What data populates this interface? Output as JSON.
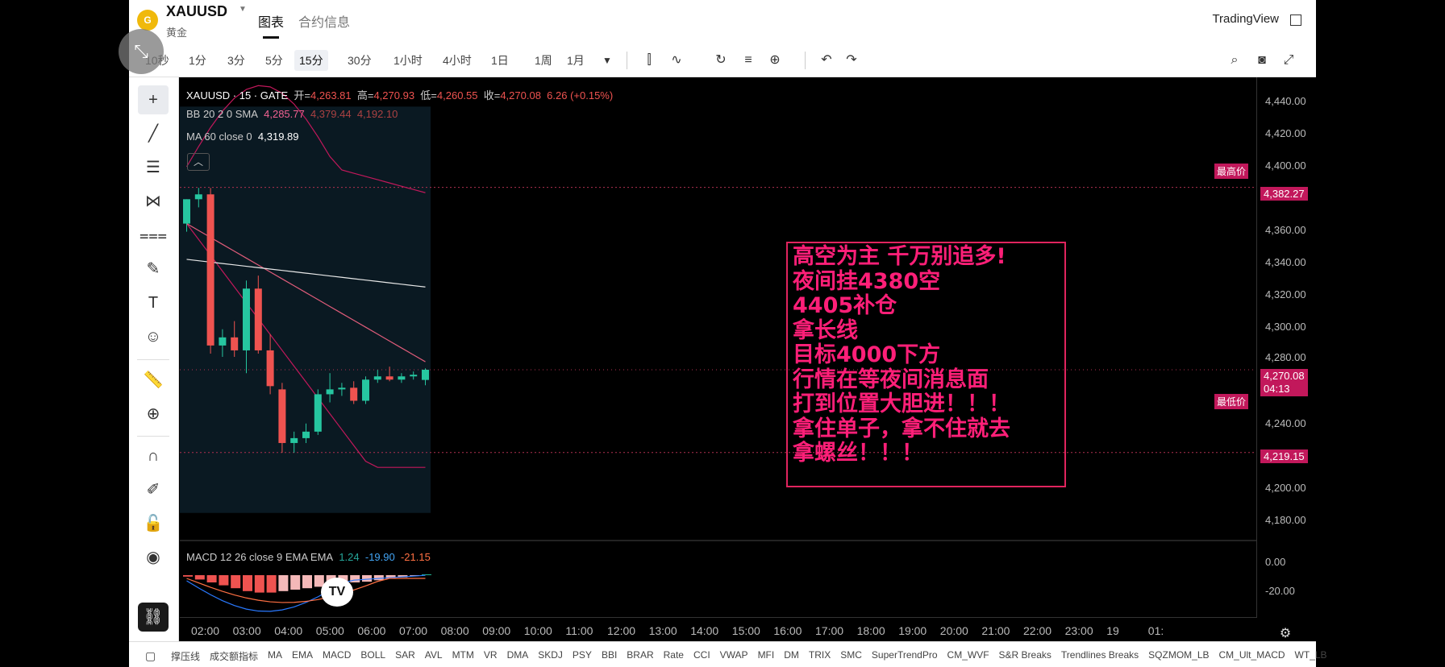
{
  "header": {
    "symbol": "XAUUSD",
    "subname": "黄金",
    "tabs": [
      {
        "label": "图表"
      },
      {
        "label": "合约信息"
      }
    ],
    "brand": "TradingView"
  },
  "toolbar": {
    "timeframes": [
      "10秒",
      "1分",
      "3分",
      "5分",
      "15分",
      "30分",
      "1小时",
      "4小时",
      "1日",
      "1周",
      "1月"
    ],
    "active_timeframe": "15分"
  },
  "legend": {
    "title": "XAUUSD · 15 · GATE",
    "open_label": "开=",
    "open": "4,263.81",
    "high_label": "高=",
    "high": "4,270.93",
    "low_label": "低=",
    "low": "4,260.55",
    "close_label": "收=",
    "close": "4,270.08",
    "change": "6.26 (+0.15%)",
    "bb_label": "BB 20 2 0 SMA",
    "bb_mid": "4,285.77",
    "bb_up": "4,379.44",
    "bb_low": "4,192.10",
    "ma_label": "MA 60 close 0",
    "ma_val": "4,319.89",
    "macd_label": "MACD 12 26 close 9 EMA EMA",
    "macd_a": "1.24",
    "macd_b": "-19.90",
    "macd_c": "-21.15"
  },
  "price_axis": {
    "ticks": [
      "4,440.00",
      "4,420.00",
      "4,400.00",
      "4,360.00",
      "4,340.00",
      "4,320.00",
      "4,300.00",
      "4,280.00",
      "4,240.00",
      "4,200.00",
      "4,180.00"
    ],
    "high_tag_label": "最高价",
    "high_tag": "4,382.27",
    "last_price": "4,270.08",
    "countdown": "04:13",
    "low_tag_label": "最低价",
    "low_tag": "4,219.15",
    "macd_ticks": [
      "0.00",
      "-20.00"
    ]
  },
  "time_axis": [
    "02:00",
    "03:00",
    "04:00",
    "05:00",
    "06:00",
    "07:00",
    "08:00",
    "09:00",
    "10:00",
    "11:00",
    "12:00",
    "13:00",
    "14:00",
    "15:00",
    "16:00",
    "17:00",
    "18:00",
    "19:00",
    "20:00",
    "21:00",
    "22:00",
    "23:00",
    "19",
    "01:"
  ],
  "annotation": [
    "高空为主 千万别追多!",
    "夜间挂4380空",
    "4405补仓",
    "拿长线",
    "目标4000下方",
    "行情在等夜间消息面",
    "打到位置大胆进！！！",
    "拿住单子，拿不住就去",
    "拿螺丝！！！"
  ],
  "indicators": [
    "撑压线",
    "成交额指标",
    "MA",
    "EMA",
    "MACD",
    "BOLL",
    "SAR",
    "AVL",
    "MTM",
    "VR",
    "DMA",
    "SKDJ",
    "PSY",
    "BBI",
    "BRAR",
    "Rate",
    "CCI",
    "VWAP",
    "MFI",
    "DM",
    "TRIX",
    "SMC",
    "SuperTrendPro",
    "CM_WVF",
    "S&R Breaks",
    "Trendlines Breaks",
    "SQZMOM_LB",
    "CM_Ult_MACD",
    "WT_LB"
  ],
  "chart_data": {
    "type": "candlestick",
    "x": [
      "01:45",
      "02:00",
      "02:15",
      "02:30",
      "02:45",
      "03:00",
      "03:15",
      "03:30",
      "03:45",
      "04:00",
      "04:15",
      "04:30",
      "04:45",
      "05:00",
      "05:15",
      "05:30",
      "05:45",
      "06:00",
      "06:15",
      "06:30",
      "06:45"
    ],
    "candles": [
      {
        "o": 4360,
        "h": 4375,
        "l": 4355,
        "c": 4375
      },
      {
        "o": 4375,
        "h": 4382,
        "l": 4370,
        "c": 4378
      },
      {
        "o": 4378,
        "h": 4382,
        "l": 4280,
        "c": 4285
      },
      {
        "o": 4285,
        "h": 4295,
        "l": 4278,
        "c": 4290
      },
      {
        "o": 4290,
        "h": 4300,
        "l": 4278,
        "c": 4282
      },
      {
        "o": 4282,
        "h": 4325,
        "l": 4268,
        "c": 4320
      },
      {
        "o": 4320,
        "h": 4328,
        "l": 4280,
        "c": 4282
      },
      {
        "o": 4282,
        "h": 4292,
        "l": 4255,
        "c": 4260
      },
      {
        "o": 4258,
        "h": 4262,
        "l": 4219,
        "c": 4225
      },
      {
        "o": 4225,
        "h": 4232,
        "l": 4219,
        "c": 4228
      },
      {
        "o": 4228,
        "h": 4237,
        "l": 4225,
        "c": 4232
      },
      {
        "o": 4232,
        "h": 4258,
        "l": 4230,
        "c": 4255
      },
      {
        "o": 4255,
        "h": 4268,
        "l": 4250,
        "c": 4258
      },
      {
        "o": 4258,
        "h": 4262,
        "l": 4254,
        "c": 4259
      },
      {
        "o": 4259,
        "h": 4263,
        "l": 4249,
        "c": 4251
      },
      {
        "o": 4251,
        "h": 4266,
        "l": 4249,
        "c": 4264
      },
      {
        "o": 4264,
        "h": 4270,
        "l": 4262,
        "c": 4266
      },
      {
        "o": 4266,
        "h": 4272,
        "l": 4263,
        "c": 4264
      },
      {
        "o": 4264,
        "h": 4268,
        "l": 4262,
        "c": 4266
      },
      {
        "o": 4266,
        "h": 4269,
        "l": 4264,
        "c": 4267
      },
      {
        "o": 4263.81,
        "h": 4270.93,
        "l": 4260.55,
        "c": 4270.08
      }
    ],
    "ylim": [
      4165,
      4450
    ],
    "hlines": {
      "high": 4382.27,
      "low": 4219.15,
      "last": 4270.08
    }
  }
}
